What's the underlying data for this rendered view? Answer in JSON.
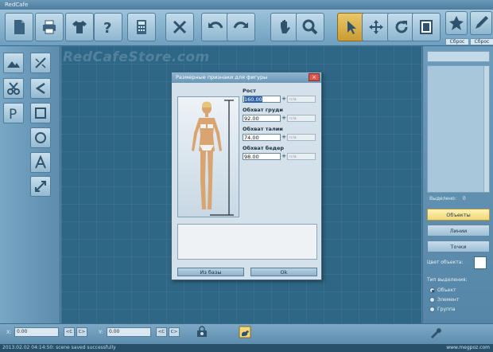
{
  "window": {
    "title": "RedCafe"
  },
  "canvas": {
    "watermark": "RedCafeStore.com"
  },
  "toolbar": {
    "buttons": [
      {
        "name": "new-document-button",
        "icon": "document-icon"
      },
      {
        "name": "print-button",
        "icon": "printer-icon"
      },
      {
        "name": "shirt-button",
        "icon": "shirt-icon"
      },
      {
        "name": "help-button",
        "icon": "question-icon"
      },
      {
        "name": "calculator-button",
        "icon": "calculator-icon"
      },
      {
        "name": "cut-button",
        "icon": "scissors-x-icon"
      },
      {
        "name": "undo-button",
        "icon": "undo-icon"
      },
      {
        "name": "redo-button",
        "icon": "redo-icon"
      },
      {
        "name": "pan-button",
        "icon": "hand-icon"
      },
      {
        "name": "zoom-button",
        "icon": "magnifier-icon"
      },
      {
        "name": "select-button",
        "icon": "cursor-icon"
      },
      {
        "name": "move-button",
        "icon": "move-icon"
      },
      {
        "name": "rotate-button",
        "icon": "rotate-icon"
      },
      {
        "name": "mirror-button",
        "icon": "mirror-icon"
      },
      {
        "name": "pin-tool-button",
        "icon": "pin-icon"
      },
      {
        "name": "pencil-tool-button",
        "icon": "pencil-icon"
      }
    ],
    "reset_label": "Сброс"
  },
  "dialog": {
    "title": "Размерные признаки для фигуры",
    "close_label": "×",
    "fields": [
      {
        "label": "Рост",
        "value": "160.00",
        "unit": "n/a"
      },
      {
        "label": "Обхват груди",
        "value": "92.00",
        "unit": "n/a"
      },
      {
        "label": "Обхват талии",
        "value": "74.00",
        "unit": "n/a"
      },
      {
        "label": "Обхват бедер",
        "value": "98.00",
        "unit": "n/a"
      }
    ],
    "plus_label": "+",
    "btn_from_base": "Из базы",
    "btn_ok": "Ok"
  },
  "right_panel": {
    "selected_label": "Выделено:",
    "selected_count": "0",
    "btn_objects": "Объекты",
    "btn_lines": "Линии",
    "btn_points": "Точки",
    "color_label": "Цвет объекта:",
    "color_value": "#ffffff",
    "selection_type_label": "Тип выделения:",
    "radios": [
      {
        "label": "Объект",
        "checked": true
      },
      {
        "label": "Элемент",
        "checked": false
      },
      {
        "label": "Группа",
        "checked": false
      }
    ]
  },
  "bottom": {
    "x_label": "X:",
    "x_value": "0.00",
    "y_label": "Y:",
    "y_value": "0.00",
    "btn_left": "<C",
    "btn_right": "C>"
  },
  "status": {
    "message": "2013.02.02 04:14:50: scene saved successfully",
    "site": "www.megpoz.com"
  }
}
